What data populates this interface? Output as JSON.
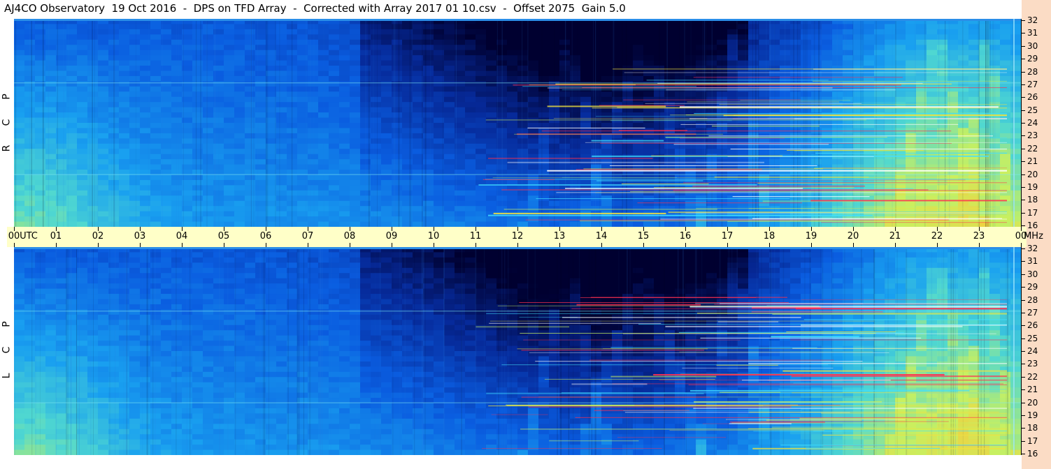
{
  "title": "AJ4CO Observatory  19 Oct 2016  -  DPS on TFD Array  -  Corrected with Array 2017 01 10.csv  -  Offset 2075  Gain 5.0",
  "chart_data": [
    {
      "type": "heatmap",
      "panel": "RCP",
      "panel_label": "R C P",
      "x_range_utc_hours": [
        0,
        24
      ],
      "y_range_mhz": [
        16,
        32
      ],
      "colormap": [
        "#000030",
        "#062a9a",
        "#0a5de0",
        "#19a0f0",
        "#50d8d0",
        "#c8f060",
        "#f0d040",
        "#ff3050",
        "#ffffff"
      ]
    },
    {
      "type": "heatmap",
      "panel": "LCP",
      "panel_label": "L C P",
      "x_range_utc_hours": [
        0,
        24
      ],
      "y_range_mhz": [
        16,
        32
      ],
      "colormap": [
        "#000030",
        "#062a9a",
        "#0a5de0",
        "#19a0f0",
        "#50d8d0",
        "#c8f060",
        "#f0d040",
        "#ff3050",
        "#ffffff"
      ]
    }
  ],
  "time_axis": {
    "ticks": [
      "00",
      "01",
      "02",
      "03",
      "04",
      "05",
      "06",
      "07",
      "08",
      "09",
      "10",
      "11",
      "12",
      "13",
      "14",
      "15",
      "16",
      "17",
      "18",
      "19",
      "20",
      "21",
      "22",
      "23",
      "00"
    ],
    "unit_left": "UTC",
    "unit_right": "MHz"
  },
  "freq_axis": {
    "ticks": [
      "32",
      "31",
      "30",
      "29",
      "28",
      "27",
      "26",
      "25",
      "24",
      "23",
      "22",
      "21",
      "20",
      "19",
      "18",
      "17",
      "16"
    ]
  }
}
